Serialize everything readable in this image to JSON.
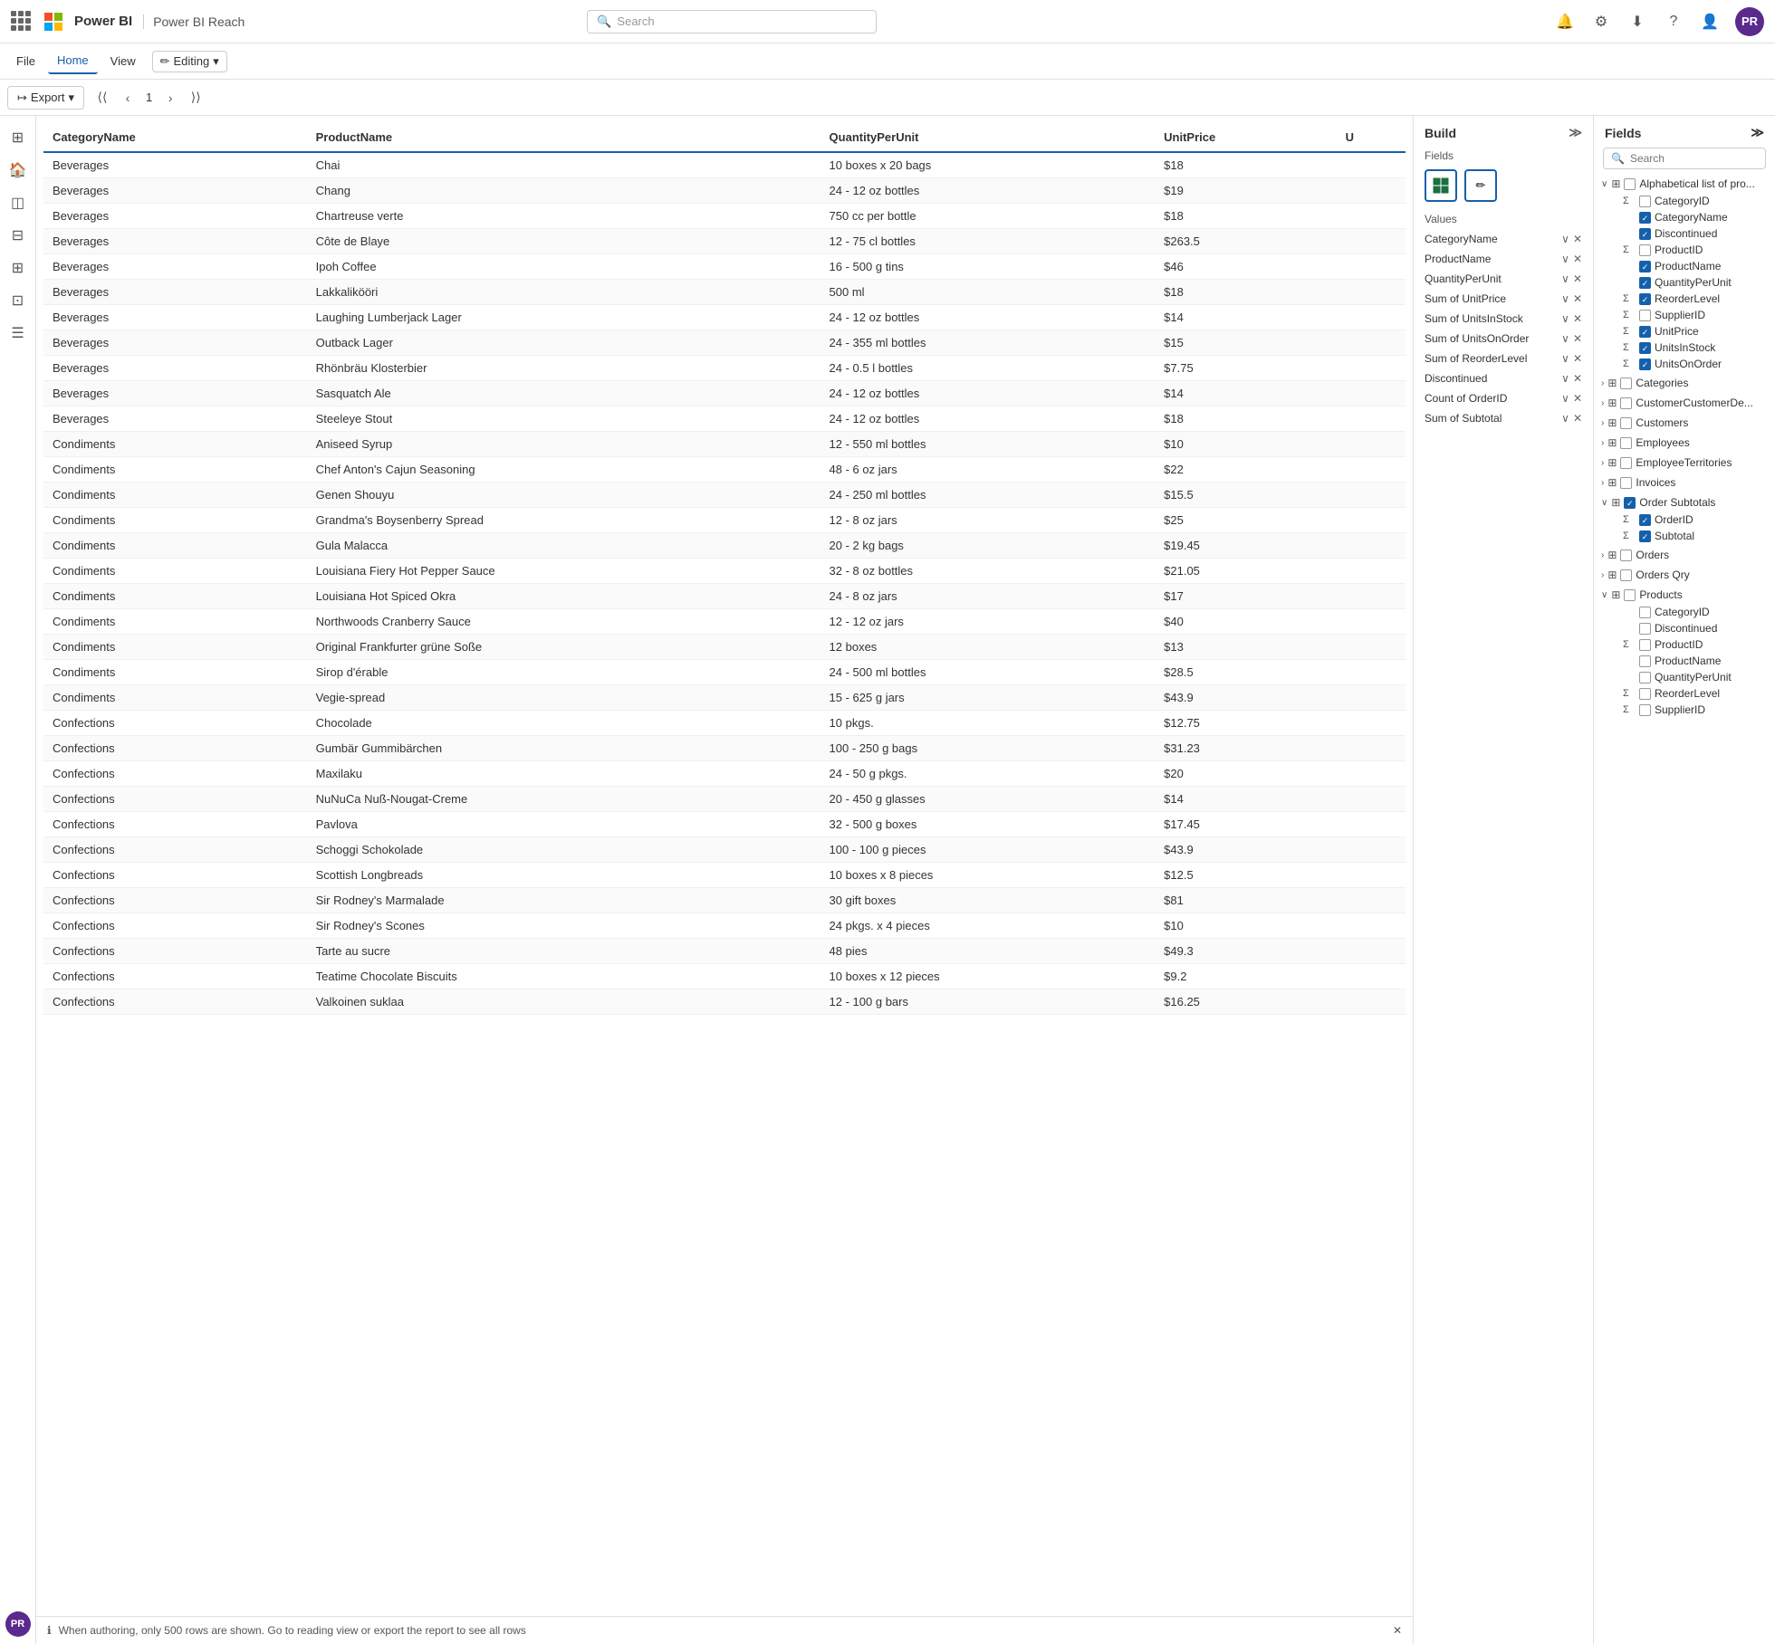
{
  "topnav": {
    "appName": "Power BI",
    "reachLabel": "Power BI Reach",
    "searchPlaceholder": "Search",
    "avatarInitials": "PR"
  },
  "ribbon": {
    "tabs": [
      "File",
      "Home",
      "View"
    ],
    "activeTab": "Home",
    "editingLabel": "Editing"
  },
  "toolbar": {
    "exportLabel": "Export",
    "pageNumber": "1"
  },
  "table": {
    "columns": [
      "CategoryName",
      "ProductName",
      "QuantityPerUnit",
      "UnitPrice",
      "U"
    ],
    "rows": [
      [
        "Beverages",
        "Chai",
        "10 boxes x 20 bags",
        "$18",
        ""
      ],
      [
        "Beverages",
        "Chang",
        "24 - 12 oz bottles",
        "$19",
        ""
      ],
      [
        "Beverages",
        "Chartreuse verte",
        "750 cc per bottle",
        "$18",
        ""
      ],
      [
        "Beverages",
        "Côte de Blaye",
        "12 - 75 cl bottles",
        "$263.5",
        ""
      ],
      [
        "Beverages",
        "Ipoh Coffee",
        "16 - 500 g tins",
        "$46",
        ""
      ],
      [
        "Beverages",
        "Lakkalikööri",
        "500 ml",
        "$18",
        ""
      ],
      [
        "Beverages",
        "Laughing Lumberjack Lager",
        "24 - 12 oz bottles",
        "$14",
        ""
      ],
      [
        "Beverages",
        "Outback Lager",
        "24 - 355 ml bottles",
        "$15",
        ""
      ],
      [
        "Beverages",
        "Rhönbräu Klosterbier",
        "24 - 0.5 l bottles",
        "$7.75",
        ""
      ],
      [
        "Beverages",
        "Sasquatch Ale",
        "24 - 12 oz bottles",
        "$14",
        ""
      ],
      [
        "Beverages",
        "Steeleye Stout",
        "24 - 12 oz bottles",
        "$18",
        ""
      ],
      [
        "Condiments",
        "Aniseed Syrup",
        "12 - 550 ml bottles",
        "$10",
        ""
      ],
      [
        "Condiments",
        "Chef Anton's Cajun Seasoning",
        "48 - 6 oz jars",
        "$22",
        ""
      ],
      [
        "Condiments",
        "Genen Shouyu",
        "24 - 250 ml bottles",
        "$15.5",
        ""
      ],
      [
        "Condiments",
        "Grandma's Boysenberry Spread",
        "12 - 8 oz jars",
        "$25",
        ""
      ],
      [
        "Condiments",
        "Gula Malacca",
        "20 - 2 kg bags",
        "$19.45",
        ""
      ],
      [
        "Condiments",
        "Louisiana Fiery Hot Pepper Sauce",
        "32 - 8 oz bottles",
        "$21.05",
        ""
      ],
      [
        "Condiments",
        "Louisiana Hot Spiced Okra",
        "24 - 8 oz jars",
        "$17",
        ""
      ],
      [
        "Condiments",
        "Northwoods Cranberry Sauce",
        "12 - 12 oz jars",
        "$40",
        ""
      ],
      [
        "Condiments",
        "Original Frankfurter grüne Soße",
        "12 boxes",
        "$13",
        ""
      ],
      [
        "Condiments",
        "Sirop d'érable",
        "24 - 500 ml bottles",
        "$28.5",
        ""
      ],
      [
        "Condiments",
        "Vegie-spread",
        "15 - 625 g jars",
        "$43.9",
        ""
      ],
      [
        "Confections",
        "Chocolade",
        "10 pkgs.",
        "$12.75",
        ""
      ],
      [
        "Confections",
        "Gumbär Gummibärchen",
        "100 - 250 g bags",
        "$31.23",
        ""
      ],
      [
        "Confections",
        "Maxilaku",
        "24 - 50 g pkgs.",
        "$20",
        ""
      ],
      [
        "Confections",
        "NuNuCa Nuß-Nougat-Creme",
        "20 - 450 g glasses",
        "$14",
        ""
      ],
      [
        "Confections",
        "Pavlova",
        "32 - 500 g boxes",
        "$17.45",
        ""
      ],
      [
        "Confections",
        "Schoggi Schokolade",
        "100 - 100 g pieces",
        "$43.9",
        ""
      ],
      [
        "Confections",
        "Scottish Longbreads",
        "10 boxes x 8 pieces",
        "$12.5",
        ""
      ],
      [
        "Confections",
        "Sir Rodney's Marmalade",
        "30 gift boxes",
        "$81",
        ""
      ],
      [
        "Confections",
        "Sir Rodney's Scones",
        "24 pkgs. x 4 pieces",
        "$10",
        ""
      ],
      [
        "Confections",
        "Tarte au sucre",
        "48 pies",
        "$49.3",
        ""
      ],
      [
        "Confections",
        "Teatime Chocolate Biscuits",
        "10 boxes x 12 pieces",
        "$9.2",
        ""
      ],
      [
        "Confections",
        "Valkoinen suklaa",
        "12 - 100 g bars",
        "$16.25",
        ""
      ]
    ],
    "footerNote": "When authoring, only 500 rows are shown. Go to reading view or export the report to see all rows"
  },
  "build": {
    "title": "Build",
    "fieldsLabel": "Fields",
    "valuesLabel": "Values",
    "values": [
      "CategoryName",
      "ProductName",
      "QuantityPerUnit",
      "Sum of UnitPrice",
      "Sum of UnitsInStock",
      "Sum of UnitsOnOrder",
      "Sum of ReorderLevel",
      "Discontinued",
      "Count of OrderID",
      "Sum of Subtotal"
    ]
  },
  "fields": {
    "title": "Fields",
    "searchPlaceholder": "Search",
    "tree": [
      {
        "name": "Alphabetical list of pro...",
        "expanded": true,
        "icon": "table",
        "children": [
          {
            "type": "sigma",
            "label": "CategoryID",
            "checked": false
          },
          {
            "type": "check",
            "label": "CategoryName",
            "checked": true
          },
          {
            "type": "check",
            "label": "Discontinued",
            "checked": true
          },
          {
            "type": "sigma",
            "label": "ProductID",
            "checked": false
          },
          {
            "type": "check",
            "label": "ProductName",
            "checked": true
          },
          {
            "type": "check",
            "label": "QuantityPerUnit",
            "checked": true
          },
          {
            "type": "sigma",
            "label": "ReorderLevel",
            "checked": true
          },
          {
            "type": "sigma",
            "label": "SupplierID",
            "checked": false
          },
          {
            "type": "sigma",
            "label": "UnitPrice",
            "checked": true
          },
          {
            "type": "sigma",
            "label": "UnitsInStock",
            "checked": true
          },
          {
            "type": "sigma",
            "label": "UnitsOnOrder",
            "checked": true
          }
        ]
      },
      {
        "name": "Categories",
        "expanded": false,
        "icon": "table",
        "children": []
      },
      {
        "name": "CustomerCustomerDe...",
        "expanded": false,
        "icon": "table",
        "children": []
      },
      {
        "name": "Customers",
        "expanded": false,
        "icon": "table",
        "children": []
      },
      {
        "name": "Employees",
        "expanded": false,
        "icon": "table",
        "children": []
      },
      {
        "name": "EmployeeTerritories",
        "expanded": false,
        "icon": "table",
        "children": []
      },
      {
        "name": "Invoices",
        "expanded": false,
        "icon": "table",
        "children": []
      },
      {
        "name": "Order Subtotals",
        "expanded": true,
        "icon": "table",
        "checked": true,
        "children": [
          {
            "type": "sigma",
            "label": "OrderID",
            "checked": true
          },
          {
            "type": "sigma",
            "label": "Subtotal",
            "checked": true
          }
        ]
      },
      {
        "name": "Orders",
        "expanded": false,
        "icon": "table",
        "children": []
      },
      {
        "name": "Orders Qry",
        "expanded": false,
        "icon": "table",
        "children": []
      },
      {
        "name": "Products",
        "expanded": true,
        "icon": "table",
        "children": [
          {
            "type": "check",
            "label": "CategoryID",
            "checked": false
          },
          {
            "type": "check",
            "label": "Discontinued",
            "checked": false
          },
          {
            "type": "sigma",
            "label": "ProductID",
            "checked": false
          },
          {
            "type": "check",
            "label": "ProductName",
            "checked": false
          },
          {
            "type": "check",
            "label": "QuantityPerUnit",
            "checked": false
          },
          {
            "type": "sigma",
            "label": "ReorderLevel",
            "checked": false
          },
          {
            "type": "sigma",
            "label": "SupplierID",
            "checked": false
          }
        ]
      }
    ]
  },
  "sidebar": {
    "icons": [
      "⊞",
      "🏠",
      "◫",
      "⊟",
      "⊞",
      "⊡",
      "☰"
    ]
  }
}
